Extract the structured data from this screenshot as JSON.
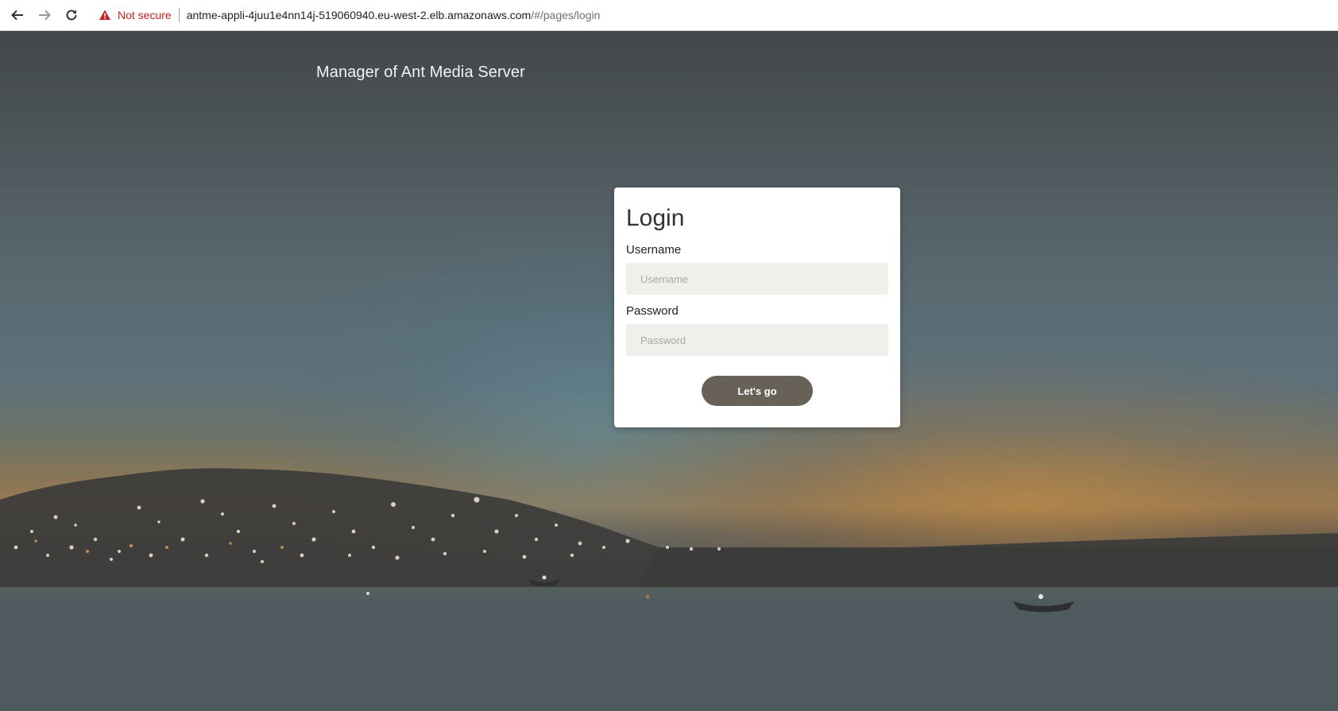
{
  "browser": {
    "security_label": "Not secure",
    "url_host": "antme-appli-4juu1e4nn14j-519060940.eu-west-2.elb.amazonaws.com",
    "url_path": "/#/pages/login",
    "icons": [
      "back-arrow-icon",
      "forward-arrow-icon",
      "reload-icon",
      "warning-icon"
    ],
    "security_color": "#c5221f"
  },
  "page": {
    "brand_title": "Manager of Ant Media Server"
  },
  "login": {
    "title": "Login",
    "username_label": "Username",
    "username_placeholder": "Username",
    "password_label": "Password",
    "password_placeholder": "Password",
    "submit_label": "Let's go",
    "button_color": "#686158"
  }
}
